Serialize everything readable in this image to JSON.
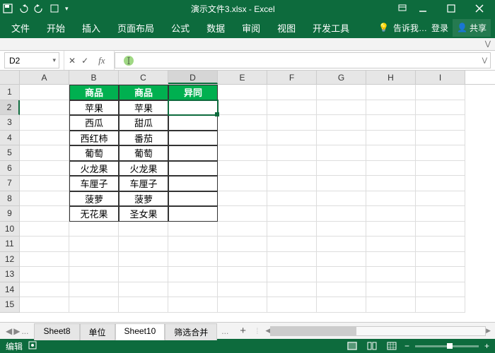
{
  "title": "演示文件3.xlsx - Excel",
  "qat_icons": [
    "save-icon",
    "undo-icon",
    "redo-icon",
    "touch-icon",
    "customize-icon"
  ],
  "ribbon": {
    "tabs": [
      "文件",
      "开始",
      "插入",
      "页面布局",
      "公式",
      "数据",
      "审阅",
      "视图",
      "开发工具"
    ],
    "tell_me": "告诉我…",
    "login": "登录",
    "share": "共享"
  },
  "namebox": "D2",
  "formula": "",
  "columns": [
    "A",
    "B",
    "C",
    "D",
    "E",
    "F",
    "G",
    "H",
    "I"
  ],
  "row_count": 15,
  "active": {
    "row": 2,
    "col": "D"
  },
  "headers": {
    "B": "商品",
    "C": "商品",
    "D": "异同"
  },
  "tableData": [
    {
      "B": "苹果",
      "C": "苹果"
    },
    {
      "B": "西瓜",
      "C": "甜瓜"
    },
    {
      "B": "西红柿",
      "C": "番茄"
    },
    {
      "B": "葡萄",
      "C": "葡萄"
    },
    {
      "B": "火龙果",
      "C": "火龙果"
    },
    {
      "B": "车厘子",
      "C": "车厘子"
    },
    {
      "B": "菠萝",
      "C": "菠萝"
    },
    {
      "B": "无花果",
      "C": "圣女果"
    }
  ],
  "sheets": {
    "list": [
      "Sheet8",
      "单位",
      "Sheet10",
      "筛选合并"
    ],
    "active": "Sheet10",
    "overflow": "...",
    "add": "+"
  },
  "status": {
    "mode": "编辑",
    "acc": "",
    "zoom_minus": "−",
    "zoom_plus": "+",
    "zoom_inc": "+"
  }
}
